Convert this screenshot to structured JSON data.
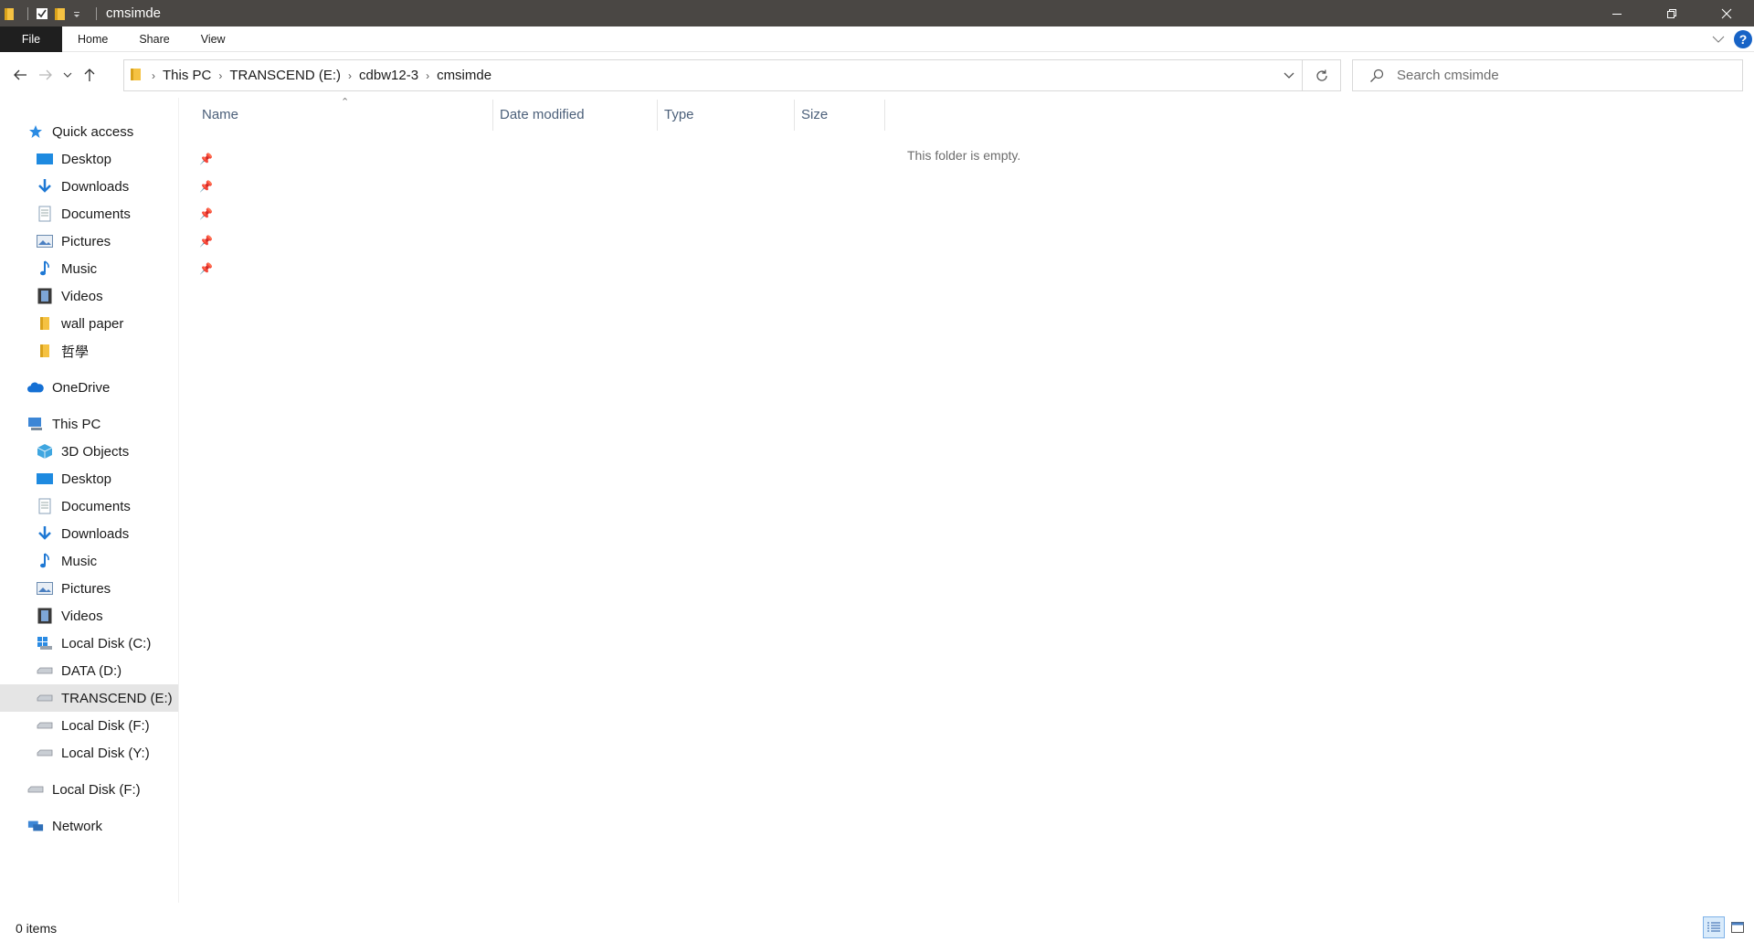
{
  "window": {
    "title": "cmsimde"
  },
  "ribbon": {
    "tabs": [
      "File",
      "Home",
      "Share",
      "View"
    ]
  },
  "address": {
    "crumbs": [
      "This PC",
      "TRANSCEND (E:)",
      "cdbw12-3",
      "cmsimde"
    ]
  },
  "search": {
    "placeholder": "Search cmsimde"
  },
  "nav": {
    "quick_access": {
      "label": "Quick access",
      "items": [
        {
          "label": "Desktop",
          "icon": "desktop-icon",
          "pinned": true
        },
        {
          "label": "Downloads",
          "icon": "downloads-icon",
          "pinned": true
        },
        {
          "label": "Documents",
          "icon": "documents-icon",
          "pinned": true
        },
        {
          "label": "Pictures",
          "icon": "pictures-icon",
          "pinned": true
        },
        {
          "label": "Music",
          "icon": "music-icon",
          "pinned": true
        },
        {
          "label": "Videos",
          "icon": "videos-icon",
          "pinned": false
        },
        {
          "label": "wall paper",
          "icon": "folder-icon",
          "pinned": false
        },
        {
          "label": "哲學",
          "icon": "folder-icon",
          "pinned": false
        }
      ]
    },
    "onedrive": {
      "label": "OneDrive"
    },
    "this_pc": {
      "label": "This PC",
      "items": [
        {
          "label": "3D Objects",
          "icon": "3d-objects-icon"
        },
        {
          "label": "Desktop",
          "icon": "desktop-icon"
        },
        {
          "label": "Documents",
          "icon": "documents-icon"
        },
        {
          "label": "Downloads",
          "icon": "downloads-icon"
        },
        {
          "label": "Music",
          "icon": "music-icon"
        },
        {
          "label": "Pictures",
          "icon": "pictures-icon"
        },
        {
          "label": "Videos",
          "icon": "videos-icon"
        },
        {
          "label": "Local Disk (C:)",
          "icon": "windows-drive-icon"
        },
        {
          "label": "DATA (D:)",
          "icon": "drive-icon"
        },
        {
          "label": "TRANSCEND (E:)",
          "icon": "drive-icon",
          "selected": true
        },
        {
          "label": "Local Disk (F:)",
          "icon": "drive-icon"
        },
        {
          "label": "Local Disk (Y:)",
          "icon": "drive-icon"
        }
      ]
    },
    "extra_drive": {
      "label": "Local Disk (F:)"
    },
    "network": {
      "label": "Network"
    }
  },
  "columns": [
    "Name",
    "Date modified",
    "Type",
    "Size"
  ],
  "empty_message": "This folder is empty.",
  "status": {
    "item_count": "0 items"
  },
  "colors": {
    "titlebar": "#4a4744",
    "file_tab": "#1f1f1f",
    "selected_nav": "#e5e5e5",
    "header_text": "#4c607a",
    "accent_blue": "#1763c6"
  }
}
